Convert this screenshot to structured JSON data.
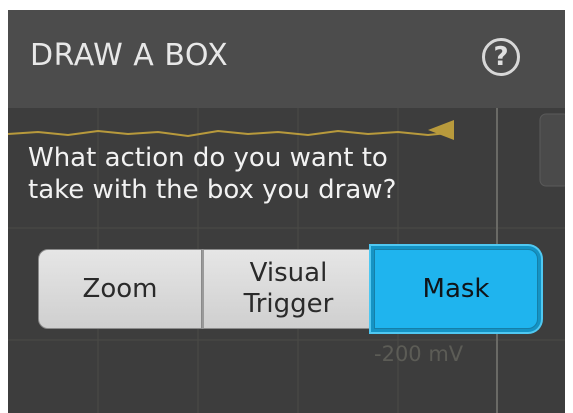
{
  "dialog": {
    "title": "DRAW A BOX",
    "help_icon": "question-circle-icon",
    "question_line1": "What action do you want to",
    "question_line2": "take with the box you draw?",
    "options": [
      {
        "label": "Zoom",
        "selected": false
      },
      {
        "label_line1": "Visual",
        "label_line2": "Trigger",
        "selected": false
      },
      {
        "label": "Mask",
        "selected": true
      }
    ],
    "background_scale_label": "-200 mV"
  },
  "colors": {
    "header": "#4c4c4c",
    "body": "#3d3d3d",
    "selected_accent": "#1fb4ee",
    "button_face": "#d9d9d9",
    "waveform_trace": "#b89a3c"
  }
}
